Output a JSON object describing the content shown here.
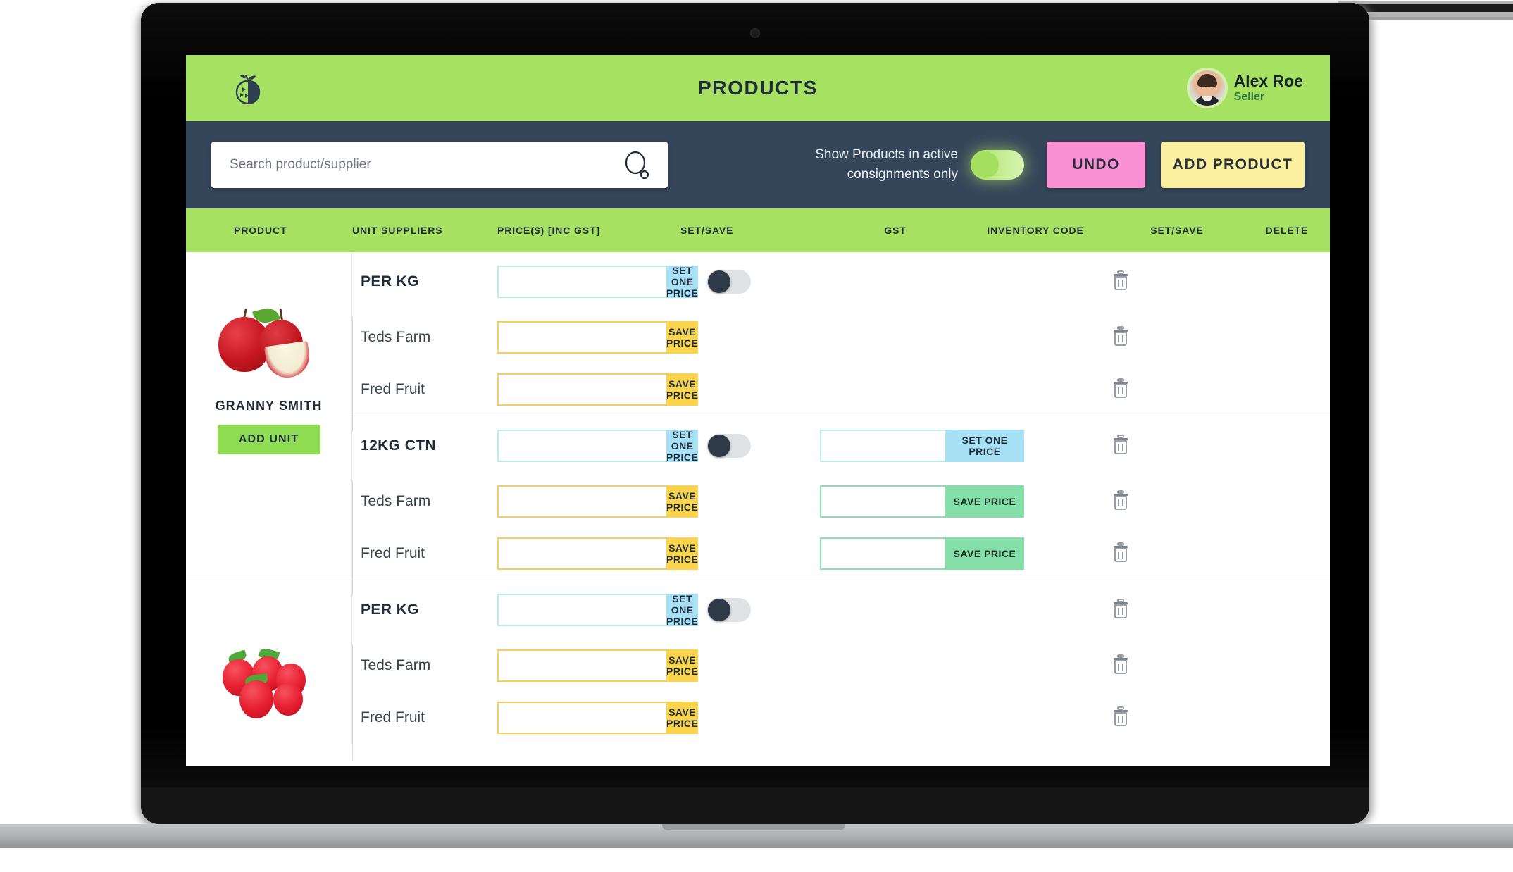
{
  "header": {
    "title": "PRODUCTS",
    "logo_icon": "apple-logo-icon",
    "user": {
      "name": "Alex Roe",
      "role": "Seller",
      "avatar_icon": "user-avatar"
    },
    "bg_color": "#a6e161"
  },
  "toolbar": {
    "search": {
      "placeholder": "Search product/supplier",
      "value": "",
      "icon": "search-icon"
    },
    "toggle": {
      "label_line1": "Show Products in active",
      "label_line2": "consignments only",
      "state": "on"
    },
    "undo_label": "UNDO",
    "add_product_label": "ADD PRODUCT",
    "bg_color": "#36465a",
    "undo_color": "#fb8fd4",
    "add_color": "#faf0a0"
  },
  "table": {
    "columns": [
      "PRODUCT",
      "UNIT SUPPLIERS",
      "PRICE($) [INC GST]",
      "SET/SAVE",
      "GST",
      "INVENTORY CODE",
      "SET/SAVE",
      "DELETE"
    ],
    "set_one_price_label": "SET ONE PRICE",
    "save_price_label": "SAVE PRICE",
    "add_unit_label": "ADD UNIT",
    "delete_icon": "trash-icon",
    "products": [
      {
        "name": "GRANNY SMITH",
        "image": "red-apples-image",
        "units": [
          {
            "unit_label": "PER KG",
            "price_value": "",
            "gst": "off",
            "has_inventory": false,
            "inventory_value": "",
            "suppliers": [
              {
                "name": "Teds Farm",
                "price_value": "",
                "inventory_value": ""
              },
              {
                "name": "Fred Fruit",
                "price_value": "",
                "inventory_value": ""
              }
            ]
          },
          {
            "unit_label": "12KG CTN",
            "price_value": "",
            "gst": "off",
            "has_inventory": true,
            "inventory_value": "",
            "suppliers": [
              {
                "name": "Teds Farm",
                "price_value": "",
                "inventory_value": ""
              },
              {
                "name": "Fred Fruit",
                "price_value": "",
                "inventory_value": ""
              }
            ]
          }
        ]
      },
      {
        "name": "",
        "image": "strawberries-image",
        "units": [
          {
            "unit_label": "PER KG",
            "price_value": "",
            "gst": "off",
            "has_inventory": false,
            "inventory_value": "",
            "suppliers": [
              {
                "name": "Teds Farm",
                "price_value": "",
                "inventory_value": ""
              },
              {
                "name": "Fred Fruit",
                "price_value": "",
                "inventory_value": ""
              }
            ]
          }
        ]
      }
    ]
  }
}
